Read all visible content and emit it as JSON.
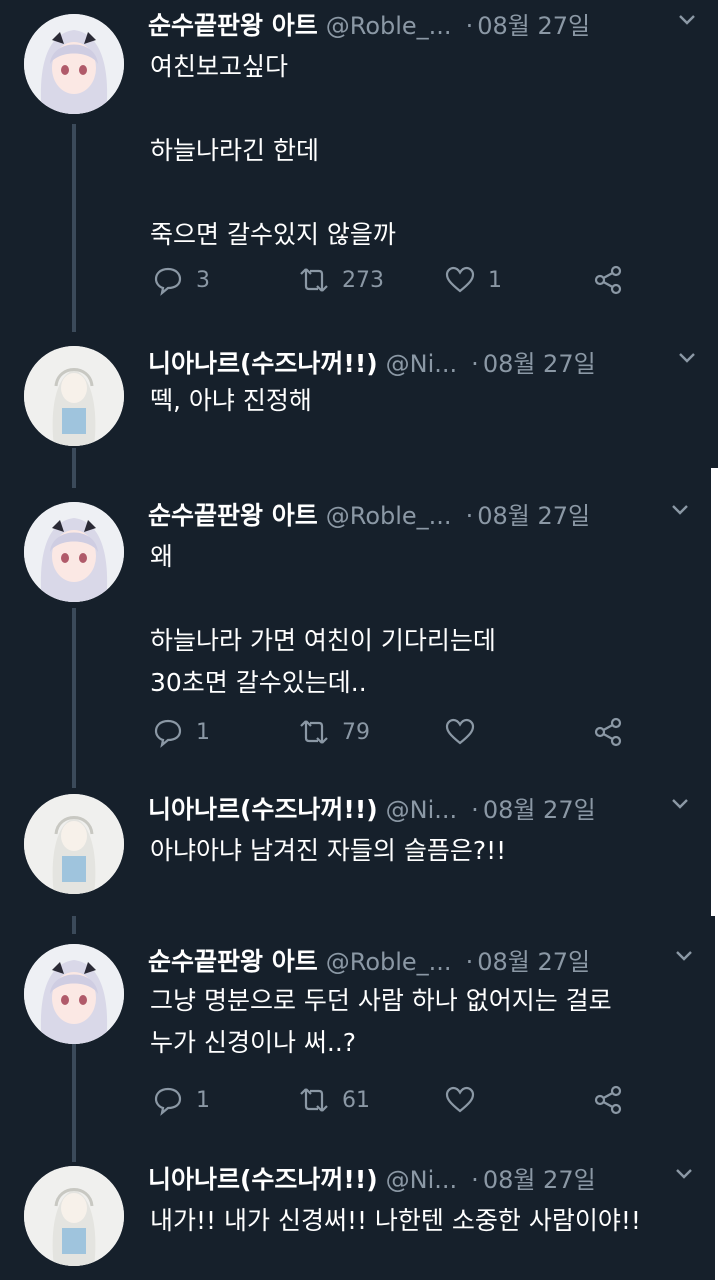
{
  "tweets": [
    {
      "author": "순수끝판왕 아트",
      "handle": "@Roble_...",
      "date": "08월 27일",
      "text": "여친보고싶다\n\n하늘나라긴 한데\n\n죽으면 갈수있지 않을까",
      "actions": {
        "reply": "3",
        "retweet": "273",
        "like": "1"
      }
    },
    {
      "author": "니아나르(수즈나꺼!!)",
      "handle": "@Ni...",
      "date": "08월 27일",
      "text": "떽, 아냐 진정해"
    },
    {
      "author": "순수끝판왕 아트",
      "handle": "@Roble_...",
      "date": "08월 27일",
      "text": "왜\n\n하늘나라 가면 여친이 기다리는데\n30초면 갈수있는데..",
      "actions": {
        "reply": "1",
        "retweet": "79",
        "like": ""
      }
    },
    {
      "author": "니아나르(수즈나꺼!!)",
      "handle": "@Ni...",
      "date": "08월 27일",
      "text": "아냐아냐 남겨진 자들의 슬픔은?!!"
    },
    {
      "author": "순수끝판왕 아트",
      "handle": "@Roble_...",
      "date": "08월 27일",
      "text": "그냥 명분으로 두던 사람 하나 없어지는 걸로\n누가 신경이나 써..?",
      "actions": {
        "reply": "1",
        "retweet": "61",
        "like": ""
      }
    },
    {
      "author": "니아나르(수즈나꺼!!)",
      "handle": "@Ni...",
      "date": "08월 27일",
      "text": "내가!! 내가 신경써!! 나한텐 소중한 사람이야!!"
    }
  ],
  "separator": "·",
  "colors": {
    "background": "#16202b",
    "text": "#ffffff",
    "muted": "#8b98a5",
    "thread": "#3b4a5a"
  }
}
